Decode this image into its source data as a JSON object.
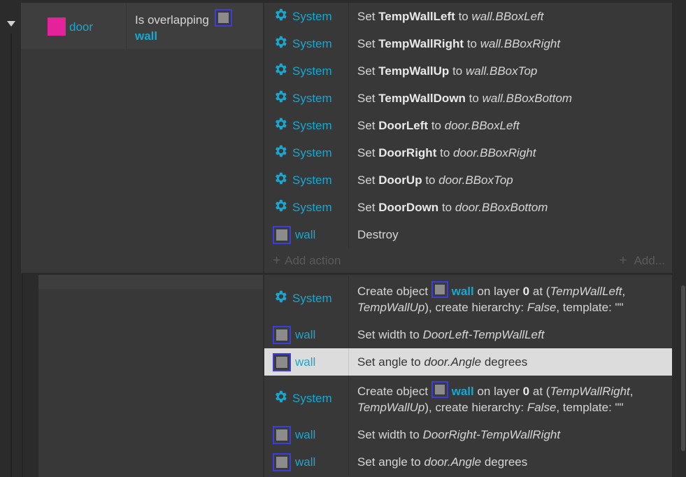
{
  "event": {
    "object_label": "door",
    "condition_prefix": "Is overlapping",
    "condition_object": "wall"
  },
  "colors": {
    "accent": "#1aa7cf",
    "door_swatch": "#e4239a",
    "wall_border": "#3c3dda",
    "highlight_row": "#dcdcdc"
  },
  "actions": [
    {
      "obj": "System",
      "icon": "gear-icon",
      "set": "Set",
      "name": "TempWallLeft",
      "to": "to",
      "value": "wall.BBoxLeft"
    },
    {
      "obj": "System",
      "icon": "gear-icon",
      "set": "Set",
      "name": "TempWallRight",
      "to": "to",
      "value": "wall.BBoxRight"
    },
    {
      "obj": "System",
      "icon": "gear-icon",
      "set": "Set",
      "name": "TempWallUp",
      "to": "to",
      "value": "wall.BBoxTop"
    },
    {
      "obj": "System",
      "icon": "gear-icon",
      "set": "Set",
      "name": "TempWallDown",
      "to": "to",
      "value": "wall.BBoxBottom"
    },
    {
      "obj": "System",
      "icon": "gear-icon",
      "set": "Set",
      "name": "DoorLeft",
      "to": "to",
      "value": "door.BBoxLeft"
    },
    {
      "obj": "System",
      "icon": "gear-icon",
      "set": "Set",
      "name": "DoorRight",
      "to": "to",
      "value": "door.BBoxRight"
    },
    {
      "obj": "System",
      "icon": "gear-icon",
      "set": "Set",
      "name": "DoorUp",
      "to": "to",
      "value": "door.BBoxTop"
    },
    {
      "obj": "System",
      "icon": "gear-icon",
      "set": "Set",
      "name": "DoorDown",
      "to": "to",
      "value": "door.BBoxBottom"
    },
    {
      "obj": "wall",
      "icon": "wall-sprite-icon",
      "text": "Destroy"
    }
  ],
  "add_action": {
    "label": "Add action",
    "right": "Add..."
  },
  "sub_actions": [
    {
      "obj": "System",
      "line1_prefix": "Create object",
      "obj_name": "wall",
      "line1_mid": "on layer",
      "layer": "0",
      "line1_at": "at (",
      "x": "TempWallLeft",
      "line1_comma": ",",
      "y": "TempWallUp",
      "line2_mid": "), create hierarchy:",
      "hier": "False",
      "line2_end": ", template: \"\""
    },
    {
      "obj": "wall",
      "prefix": "Set width to",
      "expr": "DoorLeft-TempWallLeft"
    },
    {
      "obj": "wall",
      "prefix": "Set angle to",
      "expr": "door.Angle",
      "suffix": "degrees"
    },
    {
      "obj": "System",
      "line1_prefix": "Create object",
      "obj_name": "wall",
      "line1_mid": "on layer",
      "layer": "0",
      "line1_at": "at (",
      "x": "TempWallRight",
      "line1_comma": ",",
      "y": "TempWallUp",
      "line2_mid": "), create hierarchy:",
      "hier": "False",
      "line2_end": ", template: \"\""
    },
    {
      "obj": "wall",
      "prefix": "Set width to",
      "expr": "DoorRight-TempWallRight"
    },
    {
      "obj": "wall",
      "prefix": "Set angle to",
      "expr": "door.Angle",
      "suffix": "degrees"
    }
  ]
}
